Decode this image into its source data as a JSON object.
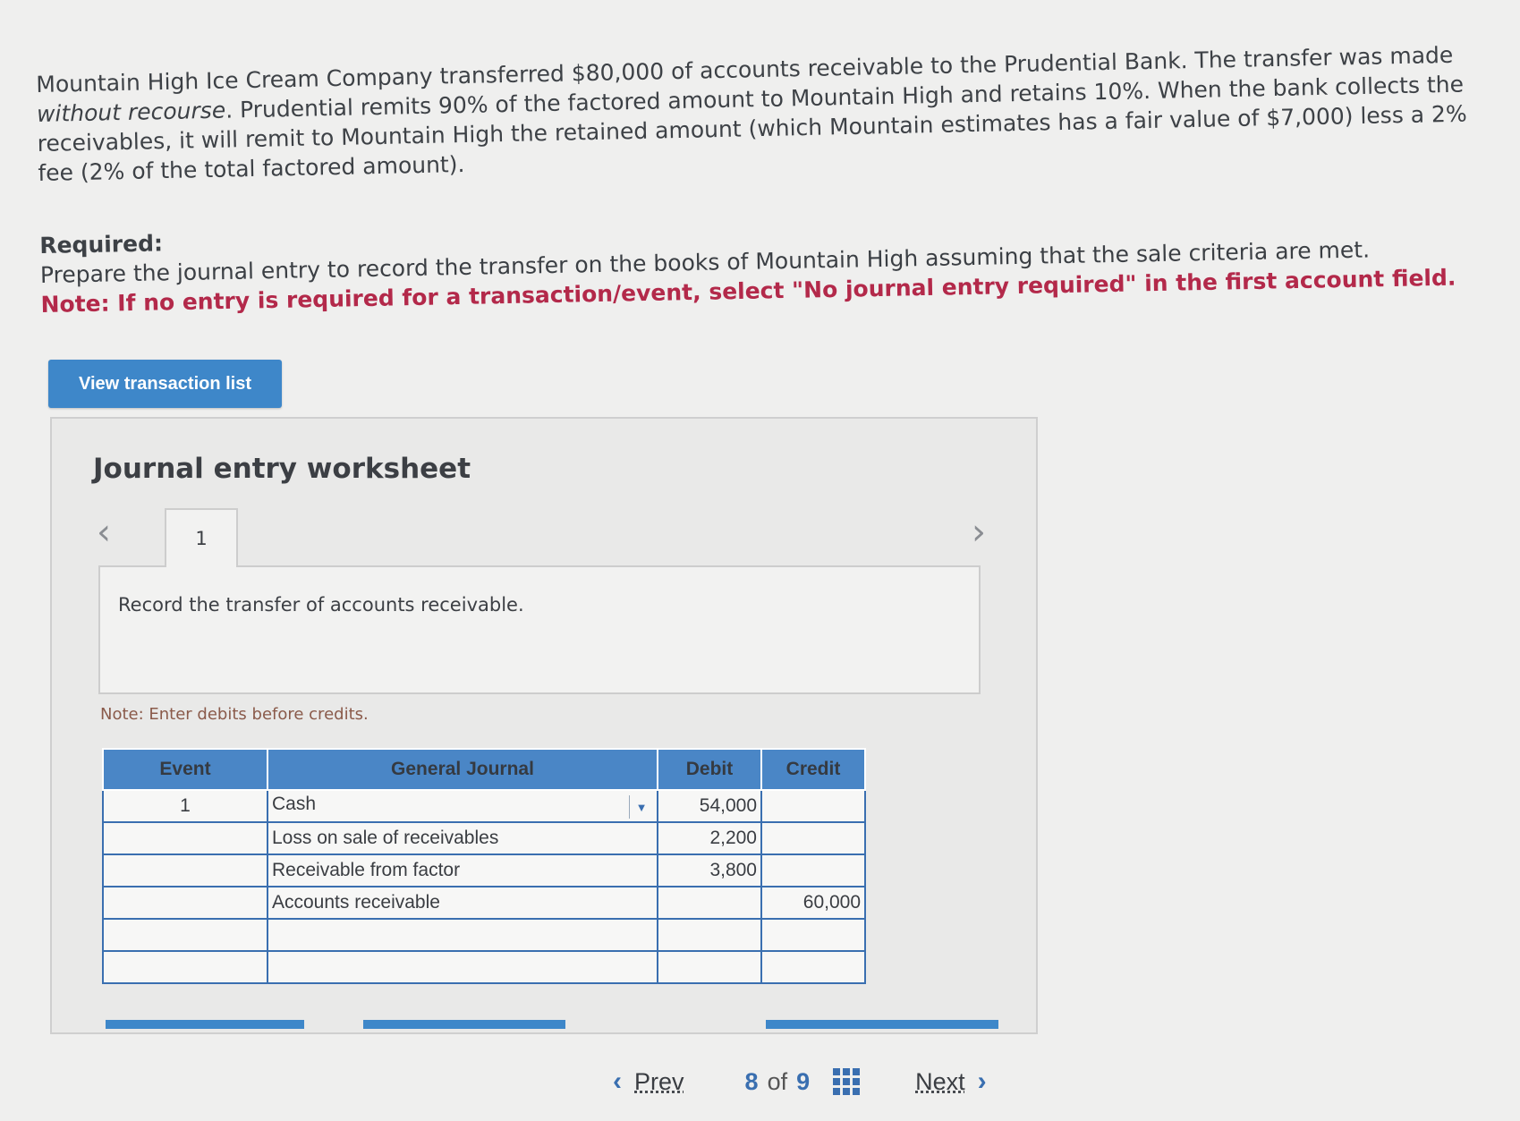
{
  "problem": {
    "text_before_italic": "Mountain High Ice Cream Company transferred $80,000 of accounts receivable to the Prudential Bank. The transfer was made ",
    "italic_text": "without recourse",
    "text_after_italic": ". Prudential remits 90% of the factored amount to Mountain High and retains 10%. When the bank collects the receivables, it will remit to Mountain High the retained amount (which Mountain estimates has a fair value of $7,000) less a 2% fee (2% of the total factored amount)."
  },
  "required": {
    "title": "Required:",
    "instruction": "Prepare the journal entry to record the transfer on the books of Mountain High assuming that the sale criteria are met.",
    "note": "Note: If no entry is required for a transaction/event, select \"No journal entry required\" in the first account field."
  },
  "view_button": "View transaction list",
  "worksheet": {
    "title": "Journal entry worksheet",
    "tab_label": "1",
    "instruction": "Record the transfer of accounts receivable.",
    "entry_note": "Note: Enter debits before credits.",
    "columns": [
      "Event",
      "General Journal",
      "Debit",
      "Credit"
    ],
    "rows": [
      {
        "event": "1",
        "account": "Cash",
        "debit": "54,000",
        "credit": ""
      },
      {
        "event": "",
        "account": "Loss on sale of receivables",
        "debit": "2,200",
        "credit": ""
      },
      {
        "event": "",
        "account": "Receivable from factor",
        "debit": "3,800",
        "credit": ""
      },
      {
        "event": "",
        "account": "Accounts receivable",
        "debit": "",
        "credit": "60,000"
      },
      {
        "event": "",
        "account": "",
        "debit": "",
        "credit": ""
      },
      {
        "event": "",
        "account": "",
        "debit": "",
        "credit": ""
      }
    ]
  },
  "pager": {
    "prev": "Prev",
    "current": "8",
    "of": "of",
    "total": "9",
    "next": "Next"
  },
  "colors": {
    "accent": "#3e87c9",
    "note_red": "#b3294a"
  }
}
